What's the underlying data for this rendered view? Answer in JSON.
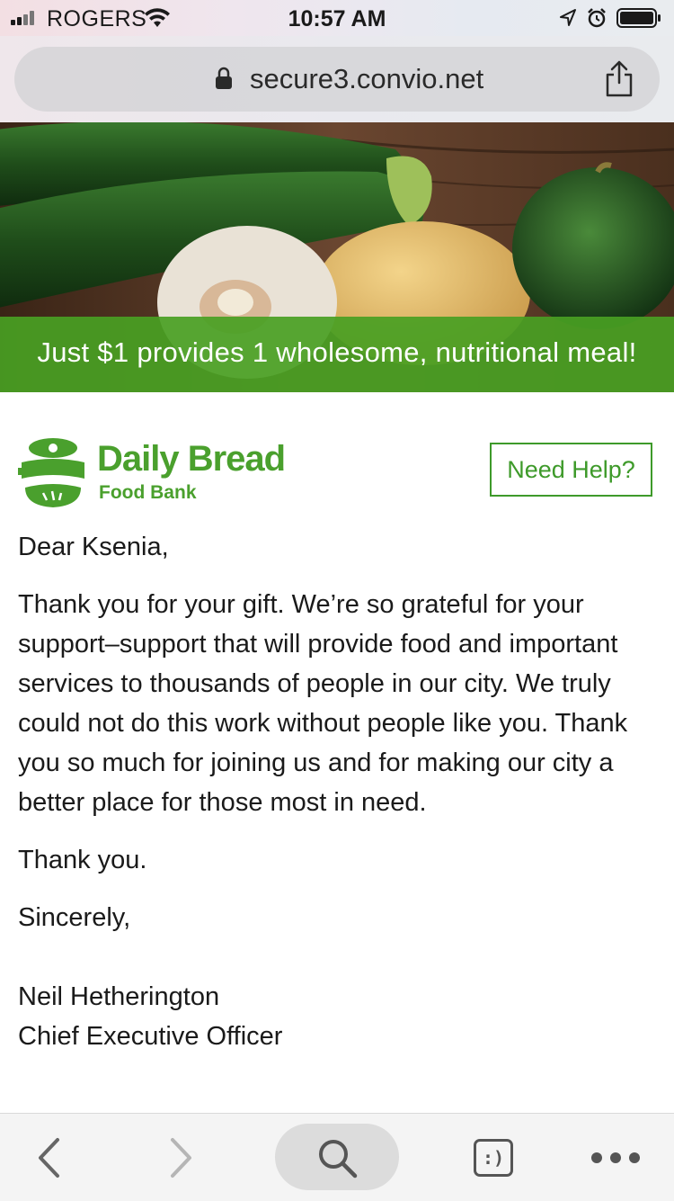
{
  "status_bar": {
    "carrier": "ROGERS",
    "time": "10:57 AM"
  },
  "browser": {
    "url": "secure3.convio.net"
  },
  "hero": {
    "banner_text": "Just $1 provides 1 wholesome, nutritional meal!",
    "colors": {
      "banner": "#49a023"
    }
  },
  "brand": {
    "name": "Daily Bread",
    "subname": "Food Bank",
    "color": "#4aa02d"
  },
  "help_button": {
    "label": "Need Help?"
  },
  "letter": {
    "greeting": "Dear Ksenia,",
    "body": "Thank you for your gift. We’re so grateful for your support–support that will provide food and important services to thousands of people in our city. We truly could not do this work without people like you. Thank you so much for joining us and for making our city a better place for those most in need.",
    "thanks": "Thank you.",
    "closing": "Sincerely,",
    "signer_name": "Neil Hetherington",
    "signer_title": "Chief Executive Officer"
  },
  "toolbar": {
    "tabs_icon_text": ":)",
    "icons": [
      "back-icon",
      "forward-icon",
      "search-icon",
      "tabs-icon",
      "more-icon"
    ]
  }
}
